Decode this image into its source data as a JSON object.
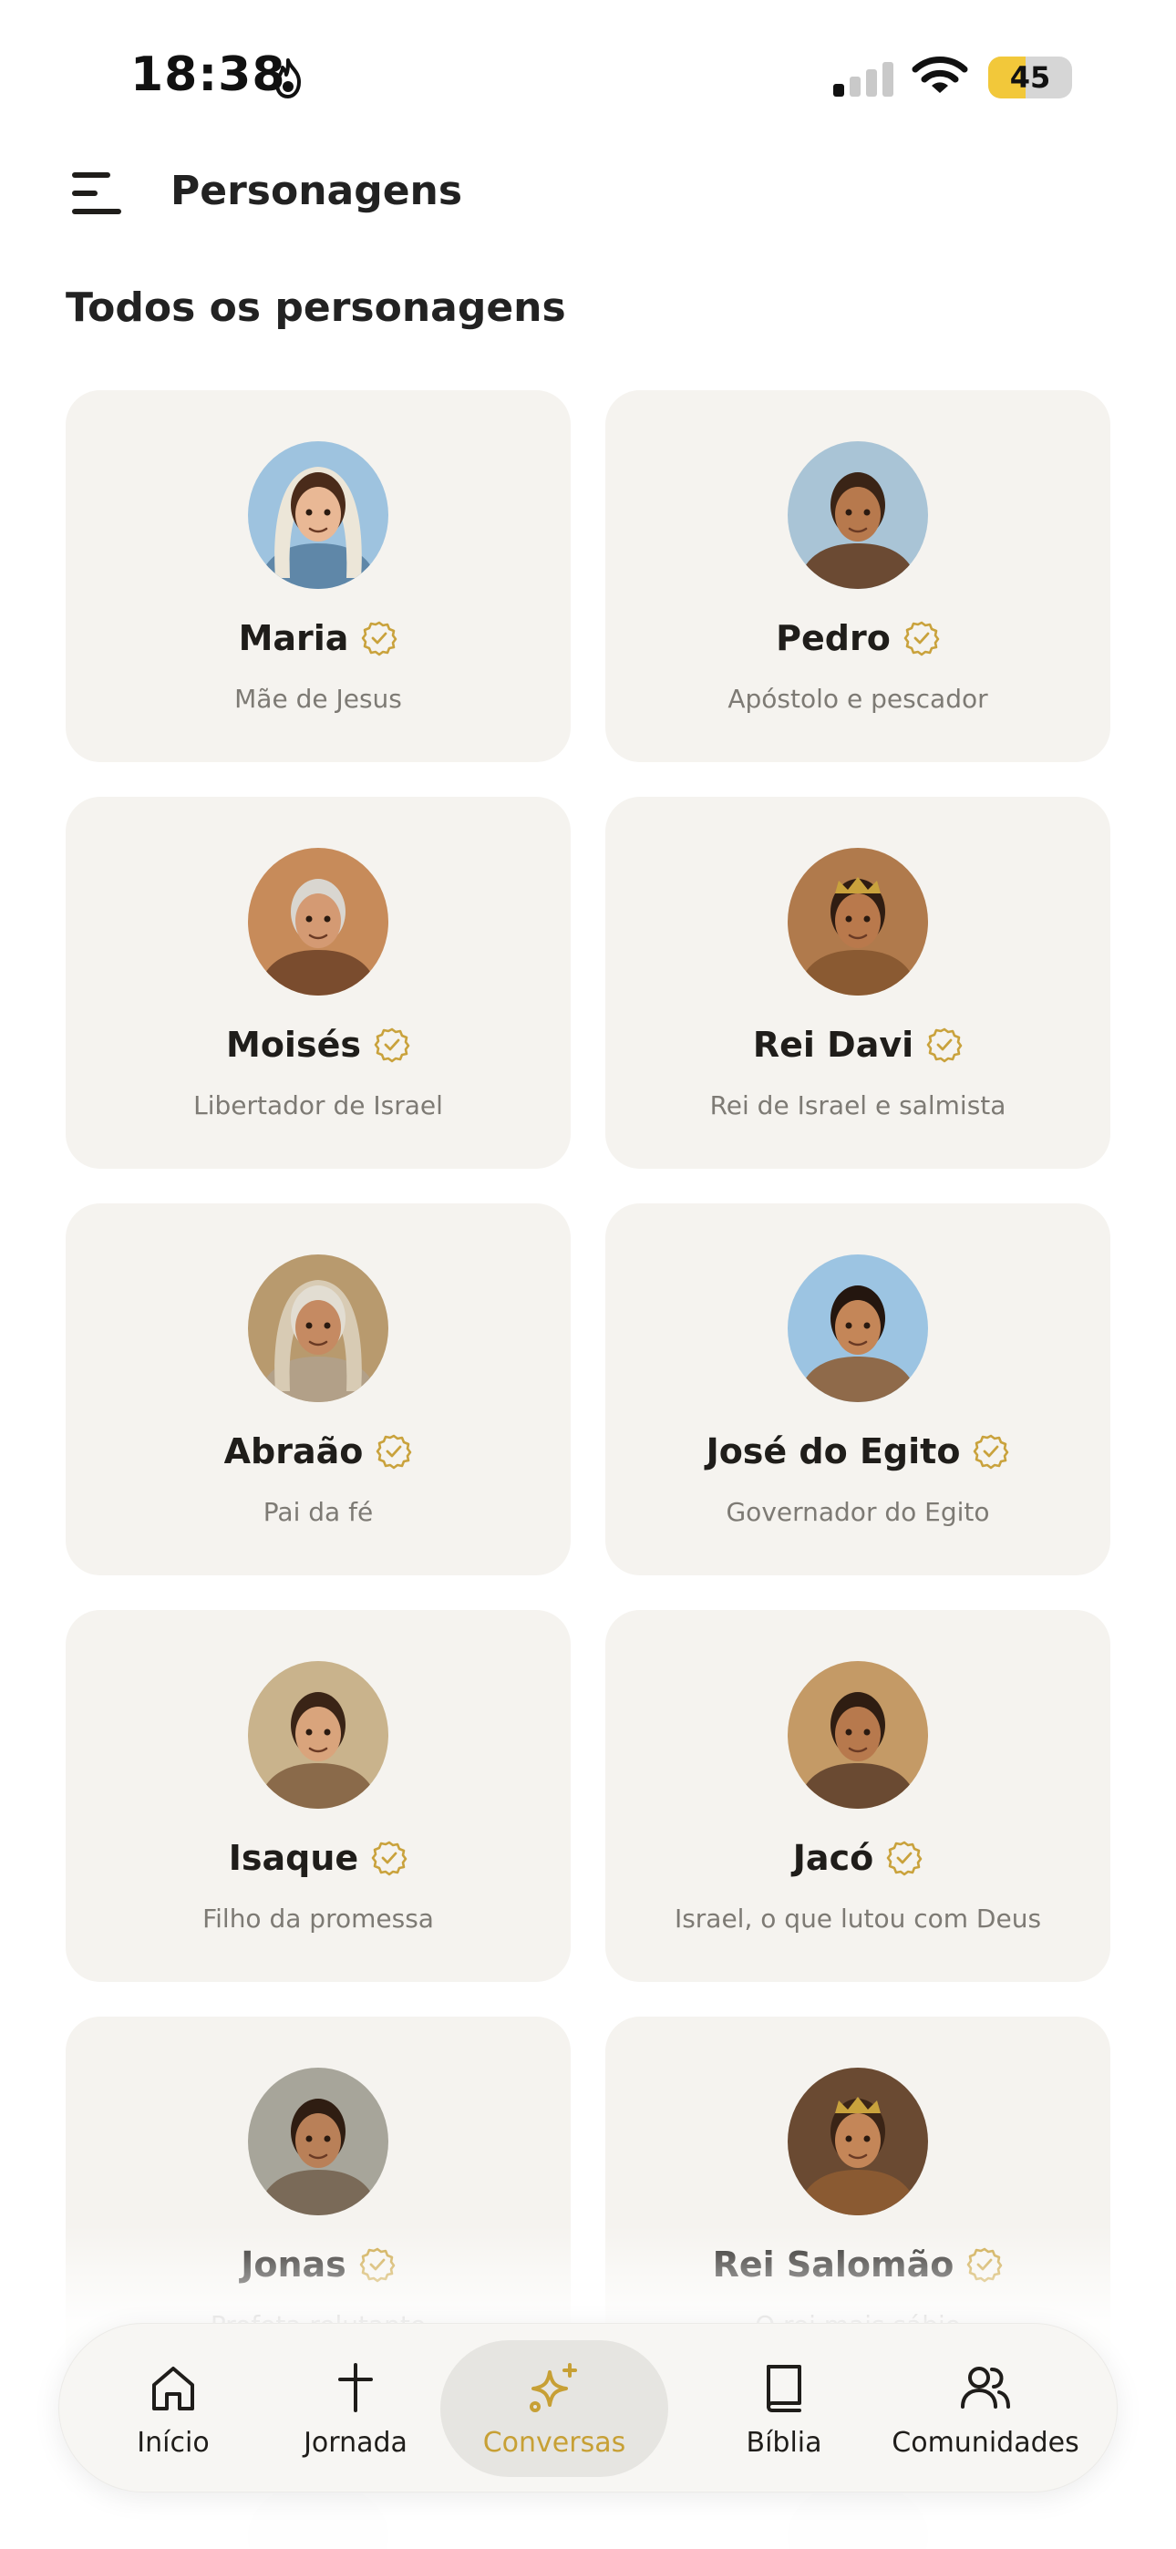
{
  "status_bar": {
    "time": "18:38",
    "battery_level": "45",
    "battery_fraction": 0.45,
    "signal_bars_on": 1,
    "signal_bars_total": 4
  },
  "header": {
    "title": "Personagens",
    "menu_icon": "menu-icon"
  },
  "section": {
    "title": "Todos os personagens"
  },
  "colors": {
    "card_bg": "#f5f3ef",
    "accent_gold": "#c7a035",
    "badge_gold": "#c9a23c",
    "subtitle_gray": "#7d7a74"
  },
  "characters": [
    {
      "name": "Maria",
      "subtitle": "Mãe de Jesus",
      "verified": true
    },
    {
      "name": "Pedro",
      "subtitle": "Apóstolo e pescador",
      "verified": true
    },
    {
      "name": "Moisés",
      "subtitle": "Libertador de Israel",
      "verified": true
    },
    {
      "name": "Rei Davi",
      "subtitle": "Rei de Israel e salmista",
      "verified": true
    },
    {
      "name": "Abraão",
      "subtitle": "Pai da fé",
      "verified": true
    },
    {
      "name": "José do Egito",
      "subtitle": "Governador do Egito",
      "verified": true
    },
    {
      "name": "Isaque",
      "subtitle": "Filho da promessa",
      "verified": true
    },
    {
      "name": "Jacó",
      "subtitle": "Israel, o que lutou com Deus",
      "verified": true
    },
    {
      "name": "Jonas",
      "subtitle": "Profeta relutante",
      "verified": true
    },
    {
      "name": "Rei Salomão",
      "subtitle": "O rei mais sábio",
      "verified": true
    }
  ],
  "bottom_nav": {
    "items": [
      {
        "label": "Início",
        "icon": "home-icon",
        "active": false
      },
      {
        "label": "Jornada",
        "icon": "cross-icon",
        "active": false
      },
      {
        "label": "Conversas",
        "icon": "sparkles-icon",
        "active": true
      },
      {
        "label": "Bíblia",
        "icon": "book-icon",
        "active": false
      },
      {
        "label": "Comunidades",
        "icon": "people-icon",
        "active": false
      }
    ]
  }
}
